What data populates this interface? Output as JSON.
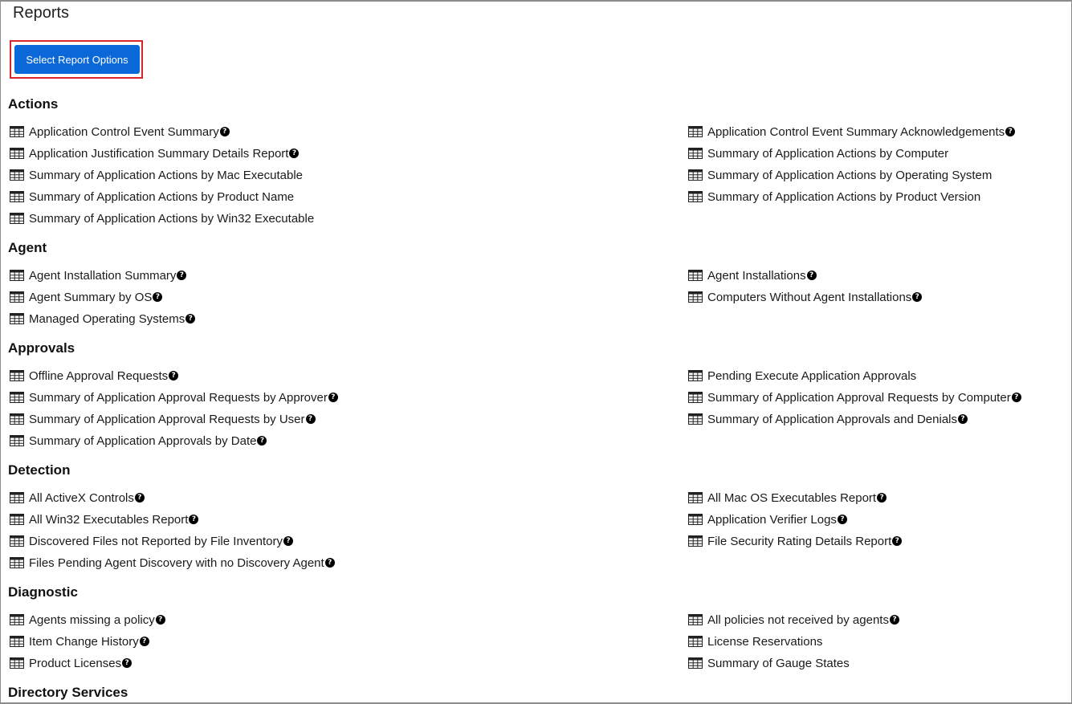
{
  "page": {
    "title": "Reports"
  },
  "toolbar": {
    "select_options_label": "Select Report Options"
  },
  "sections": [
    {
      "title": "Actions",
      "left": [
        {
          "label": "Application Control Event Summary",
          "help": true
        },
        {
          "label": "Application Justification Summary Details Report",
          "help": true
        },
        {
          "label": "Summary of Application Actions by Mac Executable",
          "help": false
        },
        {
          "label": "Summary of Application Actions by Product Name",
          "help": false
        },
        {
          "label": "Summary of Application Actions by Win32 Executable",
          "help": false
        }
      ],
      "right": [
        {
          "label": "Application Control Event Summary Acknowledgements",
          "help": true
        },
        {
          "label": "Summary of Application Actions by Computer",
          "help": false
        },
        {
          "label": "Summary of Application Actions by Operating System",
          "help": false
        },
        {
          "label": "Summary of Application Actions by Product Version",
          "help": false
        }
      ]
    },
    {
      "title": "Agent",
      "left": [
        {
          "label": "Agent Installation Summary",
          "help": true
        },
        {
          "label": "Agent Summary by OS",
          "help": true
        },
        {
          "label": "Managed Operating Systems",
          "help": true
        }
      ],
      "right": [
        {
          "label": "Agent Installations",
          "help": true
        },
        {
          "label": "Computers Without Agent Installations",
          "help": true
        }
      ]
    },
    {
      "title": "Approvals",
      "left": [
        {
          "label": "Offline Approval Requests",
          "help": true
        },
        {
          "label": "Summary of Application Approval Requests by Approver",
          "help": true
        },
        {
          "label": "Summary of Application Approval Requests by User",
          "help": true
        },
        {
          "label": "Summary of Application Approvals by Date",
          "help": true
        }
      ],
      "right": [
        {
          "label": "Pending Execute Application Approvals",
          "help": false
        },
        {
          "label": "Summary of Application Approval Requests by Computer",
          "help": true
        },
        {
          "label": "Summary of Application Approvals and Denials",
          "help": true
        }
      ]
    },
    {
      "title": "Detection",
      "left": [
        {
          "label": "All ActiveX Controls",
          "help": true
        },
        {
          "label": "All Win32 Executables Report",
          "help": true
        },
        {
          "label": "Discovered Files not Reported by File Inventory",
          "help": true
        },
        {
          "label": "Files Pending Agent Discovery with no Discovery Agent",
          "help": true
        }
      ],
      "right": [
        {
          "label": "All Mac OS Executables Report",
          "help": true
        },
        {
          "label": "Application Verifier Logs",
          "help": true
        },
        {
          "label": "File Security Rating Details Report",
          "help": true
        }
      ]
    },
    {
      "title": "Diagnostic",
      "left": [
        {
          "label": "Agents missing a policy",
          "help": true
        },
        {
          "label": "Item Change History",
          "help": true
        },
        {
          "label": "Product Licenses",
          "help": true
        }
      ],
      "right": [
        {
          "label": "All policies not received by agents",
          "help": true
        },
        {
          "label": "License Reservations",
          "help": false
        },
        {
          "label": "Summary of Gauge States",
          "help": false
        }
      ]
    },
    {
      "title": "Directory Services",
      "left": [],
      "right": []
    }
  ],
  "icons": {
    "report": "table-grid-icon",
    "help": "question-circle-icon"
  },
  "help_glyph": "?",
  "colors": {
    "primary": "#0b68d9",
    "highlight": "#d9262c"
  }
}
